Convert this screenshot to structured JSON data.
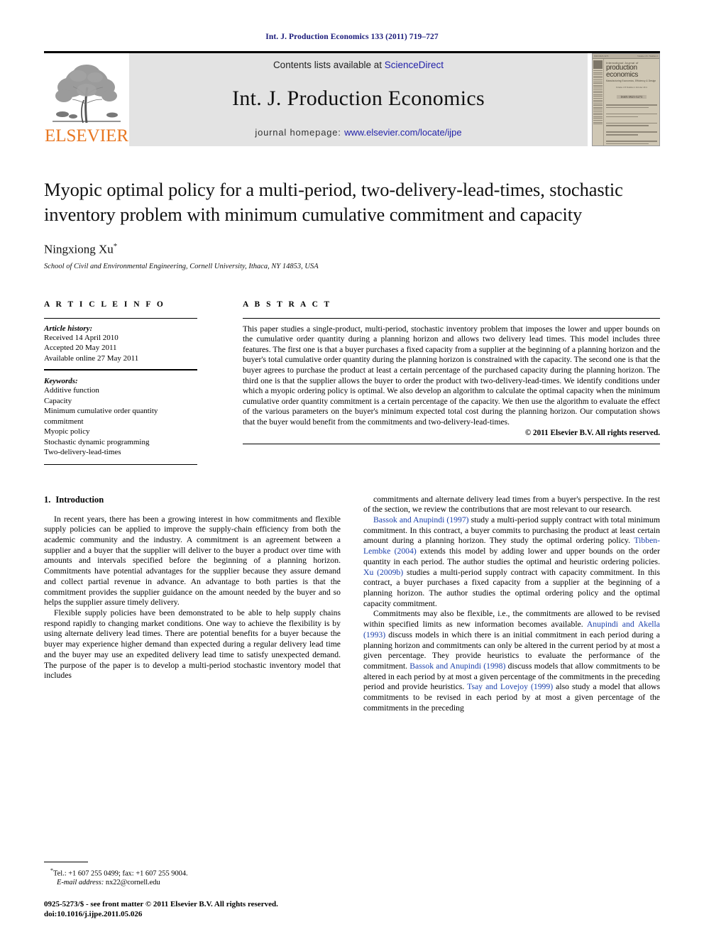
{
  "running_head": "Int. J. Production Economics 133 (2011) 719–727",
  "masthead": {
    "publisher_wordmark": "ELSEVIER",
    "contents_prefix": "Contents lists available at ",
    "contents_link": "ScienceDirect",
    "journal_title": "Int. J. Production Economics",
    "homepage_prefix": "journal homepage: ",
    "homepage_link": "www.elsevier.com/locate/ijpe",
    "cover": {
      "kicker": "International Journal of",
      "word1": "production",
      "word2": "economics",
      "subtitle": "Manufacturing Economics, Efficiency & Design",
      "mid_small": "Volume 133  Number 2  October 2011",
      "mid_badge": "ISSN 0925-5273",
      "topbar_left": "ISSN 0925-5273",
      "topbar_right": "Volume 133 / Number 2"
    }
  },
  "title": "Myopic optimal policy for a multi-period, two-delivery-lead-times, stochastic inventory problem with minimum cumulative commitment and capacity",
  "author": "Ningxiong Xu",
  "author_marker": "*",
  "affiliation": "School of Civil and Environmental Engineering, Cornell University, Ithaca, NY 14853, USA",
  "article_info": {
    "label": "A R T I C L E  I N F O",
    "history_label": "Article history:",
    "history": [
      "Received 14 April 2010",
      "Accepted 20 May 2011",
      "Available online 27 May 2011"
    ],
    "keywords_label": "Keywords:",
    "keywords": [
      "Additive function",
      "Capacity",
      "Minimum cumulative order quantity",
      "commitment",
      "Myopic policy",
      "Stochastic dynamic programming",
      "Two-delivery-lead-times"
    ]
  },
  "abstract": {
    "label": "A B S T R A C T",
    "text": "This paper studies a single-product, multi-period, stochastic inventory problem that imposes the lower and upper bounds on the cumulative order quantity during a planning horizon and allows two delivery lead times. This model includes three features. The first one is that a buyer purchases a fixed capacity from a supplier at the beginning of a planning horizon and the buyer's total cumulative order quantity during the planning horizon is constrained with the capacity. The second one is that the buyer agrees to purchase the product at least a certain percentage of the purchased capacity during the planning horizon. The third one is that the supplier allows the buyer to order the product with two-delivery-lead-times. We identify conditions under which a myopic ordering policy is optimal. We also develop an algorithm to calculate the optimal capacity when the minimum cumulative order quantity commitment is a certain percentage of the capacity. We then use the algorithm to evaluate the effect of the various parameters on the buyer's minimum expected total cost during the planning horizon. Our computation shows that the buyer would benefit from the commitments and two-delivery-lead-times.",
    "copyright": "© 2011 Elsevier B.V. All rights reserved."
  },
  "introduction": {
    "number": "1.",
    "heading": "Introduction",
    "left_paragraphs": [
      "In recent years, there has been a growing interest in how commitments and flexible supply policies can be applied to improve the supply-chain efficiency from both the academic community and the industry. A commitment is an agreement between a supplier and a buyer that the supplier will deliver to the buyer a product over time with amounts and intervals specified before the beginning of a planning horizon. Commitments have potential advantages for the supplier because they assure demand and collect partial revenue in advance. An advantage to both parties is that the commitment provides the supplier guidance on the amount needed by the buyer and so helps the supplier assure timely delivery.",
      "Flexible supply policies have been demonstrated to be able to help supply chains respond rapidly to changing market conditions. One way to achieve the flexibility is by using alternate delivery lead times. There are potential benefits for a buyer because the buyer may experience higher demand than expected during a regular delivery lead time and the buyer may use an expedited delivery lead time to satisfy unexpected demand. The purpose of the paper is to develop a multi-period stochastic inventory model that includes"
    ],
    "right_paragraphs": [
      {
        "segments": [
          {
            "text": "commitments and alternate delivery lead times from a buyer's perspective. In the rest of the section, we review the contributions that are most relevant to our research.",
            "cite": false
          }
        ]
      },
      {
        "segments": [
          {
            "text": "Bassok and Anupindi (1997)",
            "cite": true
          },
          {
            "text": " study a multi-period supply contract with total minimum commitment. In this contract, a buyer commits to purchasing the product at least certain amount during a planning horizon. They study the optimal ordering policy. ",
            "cite": false
          },
          {
            "text": "Tibben-Lembke (2004)",
            "cite": true
          },
          {
            "text": " extends this model by adding lower and upper bounds on the order quantity in each period. The author studies the optimal and heuristic ordering policies. ",
            "cite": false
          },
          {
            "text": "Xu (2009b)",
            "cite": true
          },
          {
            "text": " studies a multi-period supply contract with capacity commitment. In this contract, a buyer purchases a fixed capacity from a supplier at the beginning of a planning horizon. The author studies the optimal ordering policy and the optimal capacity commitment.",
            "cite": false
          }
        ]
      },
      {
        "segments": [
          {
            "text": "Commitments may also be flexible, i.e., the commitments are allowed to be revised within specified limits as new information becomes available. ",
            "cite": false
          },
          {
            "text": "Anupindi and Akella (1993)",
            "cite": true
          },
          {
            "text": " discuss models in which there is an initial commitment in each period during a planning horizon and commitments can only be altered in the current period by at most a given percentage. They provide heuristics to evaluate the performance of the commitment. ",
            "cite": false
          },
          {
            "text": "Bassok and Anupindi (1998)",
            "cite": true
          },
          {
            "text": " discuss models that allow commitments to be altered in each period by at most a given percentage of the commitments in the preceding period and provide heuristics. ",
            "cite": false
          },
          {
            "text": "Tsay and Lovejoy (1999)",
            "cite": true
          },
          {
            "text": " also study a model that allows commitments to be revised in each period by at most a given percentage of the commitments in the preceding",
            "cite": false
          }
        ]
      }
    ]
  },
  "footnote": {
    "marker": "*",
    "tel_fax": "Tel.: +1 607 255 0499; fax: +1 607 255 9004.",
    "email_label": "E-mail address:",
    "email": "nx22@cornell.edu"
  },
  "footer": {
    "line1": "0925-5273/$ - see front matter © 2011 Elsevier B.V. All rights reserved.",
    "line2": "doi:10.1016/j.ijpe.2011.05.026"
  },
  "colors": {
    "elsevier_orange": "#E87722",
    "link_blue": "#2222aa",
    "citation_blue": "#1a3faa",
    "running_head_navy": "#1a1a7a",
    "banner_gray": "#e3e3e3"
  }
}
